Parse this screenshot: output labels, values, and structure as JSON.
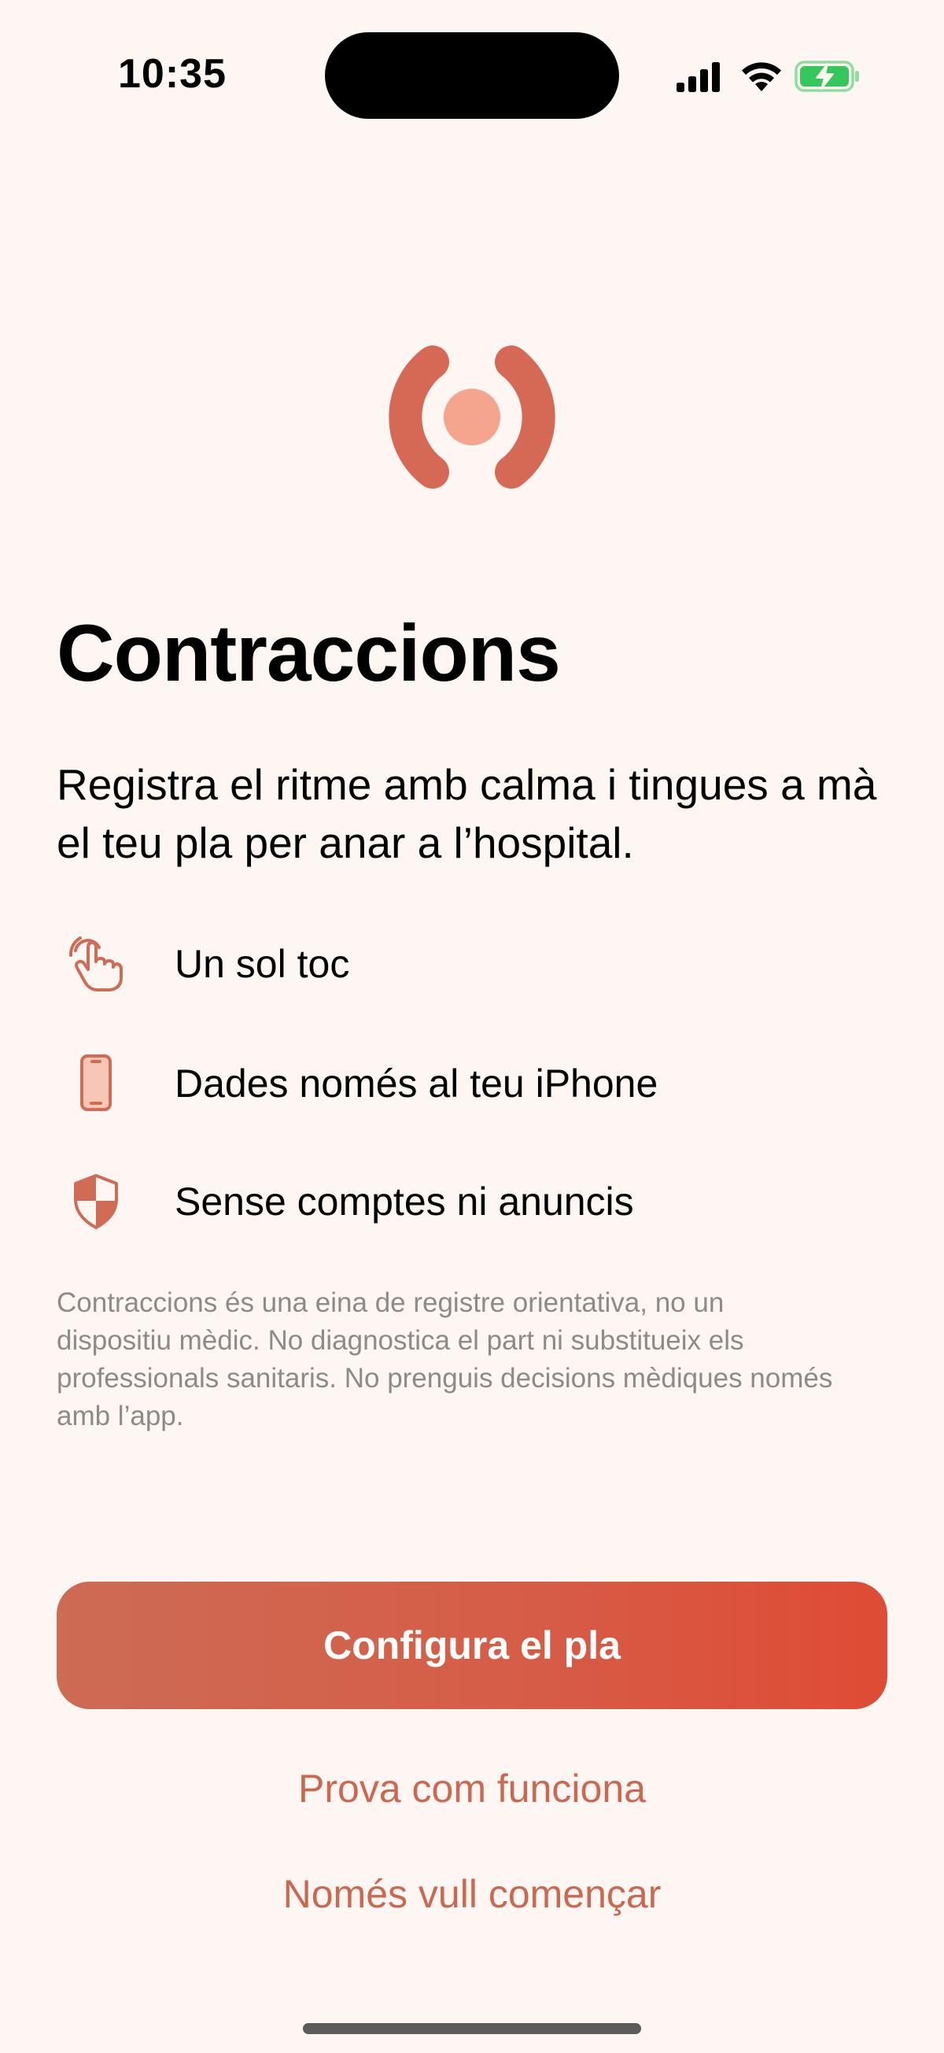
{
  "status_bar": {
    "time": "10:35"
  },
  "logo": {
    "icon": "pulse-logo-icon",
    "colors": {
      "arcs": "#D66955",
      "dot": "#F5A58D"
    }
  },
  "header": {
    "title": "Contraccions",
    "subtitle": "Registra el ritme amb calma i tingues a mà el teu pla per anar a l’hospital."
  },
  "features": [
    {
      "icon": "tap-hand-icon",
      "label": "Un sol toc"
    },
    {
      "icon": "phone-icon",
      "label": "Dades només al teu iPhone"
    },
    {
      "icon": "shield-icon",
      "label": "Sense comptes ni anuncis"
    }
  ],
  "disclaimer": "Contraccions és una eina de registre orientativa, no un dispositiu mèdic. No diagnostica el part ni substitueix els professionals sanitaris. No prenguis decisions mèdiques només amb l’app.",
  "actions": {
    "primary_label": "Configura el pla",
    "try_label": "Prova com funciona",
    "start_label": "Només vull començar"
  },
  "colors": {
    "background": "#FEF6F2",
    "accent": "#CC6750",
    "button_gradient_start": "#CD6B55",
    "button_gradient_end": "#DF4B35",
    "battery": "#34C759"
  }
}
